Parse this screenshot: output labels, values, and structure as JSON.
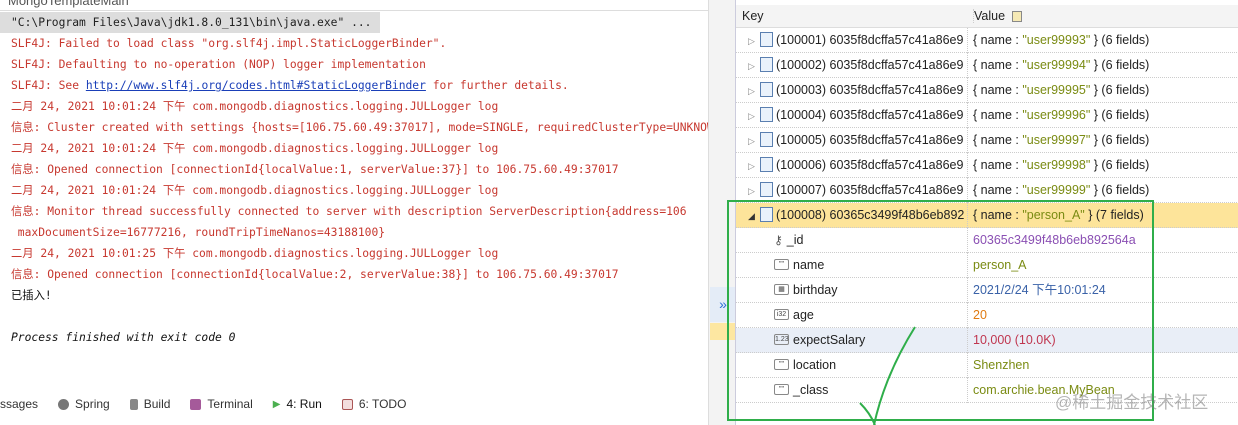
{
  "tab_title": "MongoTemplateMain",
  "console": {
    "command": "\"C:\\Program Files\\Java\\jdk1.8.0_131\\bin\\java.exe\" ...",
    "lines": [
      "SLF4J: Failed to load class \"org.slf4j.impl.StaticLoggerBinder\".",
      "SLF4J: Defaulting to no-operation (NOP) logger implementation",
      "二月 24, 2021 10:01:24 下午 com.mongodb.diagnostics.logging.JULLogger log",
      "信息: Cluster created with settings {hosts=[106.75.60.49:37017], mode=SINGLE, requiredClusterType=UNKNOWN",
      "二月 24, 2021 10:01:24 下午 com.mongodb.diagnostics.logging.JULLogger log",
      "信息: Opened connection [connectionId{localValue:1, serverValue:37}] to 106.75.60.49:37017",
      "二月 24, 2021 10:01:24 下午 com.mongodb.diagnostics.logging.JULLogger log",
      "信息: Monitor thread successfully connected to server with description ServerDescription{address=106",
      " maxDocumentSize=16777216, roundTripTimeNanos=43188100}",
      "二月 24, 2021 10:01:25 下午 com.mongodb.diagnostics.logging.JULLogger log",
      "信息: Opened connection [connectionId{localValue:2, serverValue:38}] to 106.75.60.49:37017"
    ],
    "slf4j_see_prefix": "SLF4J: See ",
    "slf4j_link": "http://www.slf4j.org/codes.html#StaticLoggerBinder",
    "slf4j_see_suffix": " for further details.",
    "inserted": "已插入!",
    "exit": "Process finished with exit code 0"
  },
  "bottom_tabs": [
    "ssages",
    "Spring",
    "Build",
    "Terminal",
    "4: Run",
    "6: TODO"
  ],
  "grid": {
    "key_header": "Key",
    "value_header": "Value",
    "rows": [
      {
        "key": "(100001) 6035f8dcffa57c41a86e9",
        "pre": "{ name : ",
        "name": "\"user99993\"",
        "post": " } (6 fields)"
      },
      {
        "key": "(100002) 6035f8dcffa57c41a86e9",
        "pre": "{ name : ",
        "name": "\"user99994\"",
        "post": " } (6 fields)"
      },
      {
        "key": "(100003) 6035f8dcffa57c41a86e9",
        "pre": "{ name : ",
        "name": "\"user99995\"",
        "post": " } (6 fields)"
      },
      {
        "key": "(100004) 6035f8dcffa57c41a86e9",
        "pre": "{ name : ",
        "name": "\"user99996\"",
        "post": " } (6 fields)"
      },
      {
        "key": "(100005) 6035f8dcffa57c41a86e9",
        "pre": "{ name : ",
        "name": "\"user99997\"",
        "post": " } (6 fields)"
      },
      {
        "key": "(100006) 6035f8dcffa57c41a86e9",
        "pre": "{ name : ",
        "name": "\"user99998\"",
        "post": " } (6 fields)"
      },
      {
        "key": "(100007) 6035f8dcffa57c41a86e9",
        "pre": "{ name : ",
        "name": "\"user99999\"",
        "post": " } (6 fields)"
      }
    ],
    "selected": {
      "key": "(100008) 60365c3499f48b6eb892",
      "pre": "{ name : ",
      "name": "\"person_A\"",
      "post": " } (7 fields)"
    },
    "fields": [
      {
        "name": "_id",
        "value": "60365c3499f48b6eb892564a",
        "type": "key",
        "color": "#8a4fb3"
      },
      {
        "name": "name",
        "value": "person_A",
        "type": "string",
        "color": "#7a8b12"
      },
      {
        "name": "birthday",
        "value": "2021/2/24 下午10:01:24",
        "type": "date",
        "color": "#3a62a8"
      },
      {
        "name": "age",
        "value": "20",
        "type": "i32",
        "color": "#e07b12"
      },
      {
        "name": "expectSalary",
        "value": "10,000 (10.0K)",
        "type": "1.23",
        "color": "#c0364f"
      },
      {
        "name": "location",
        "value": "Shenzhen",
        "type": "string",
        "color": "#7a8b12"
      },
      {
        "name": "_class",
        "value": "com.archie.bean.MyBean",
        "type": "string",
        "color": "#7a8b12"
      }
    ]
  },
  "watermark": "@稀土掘金技术社区"
}
